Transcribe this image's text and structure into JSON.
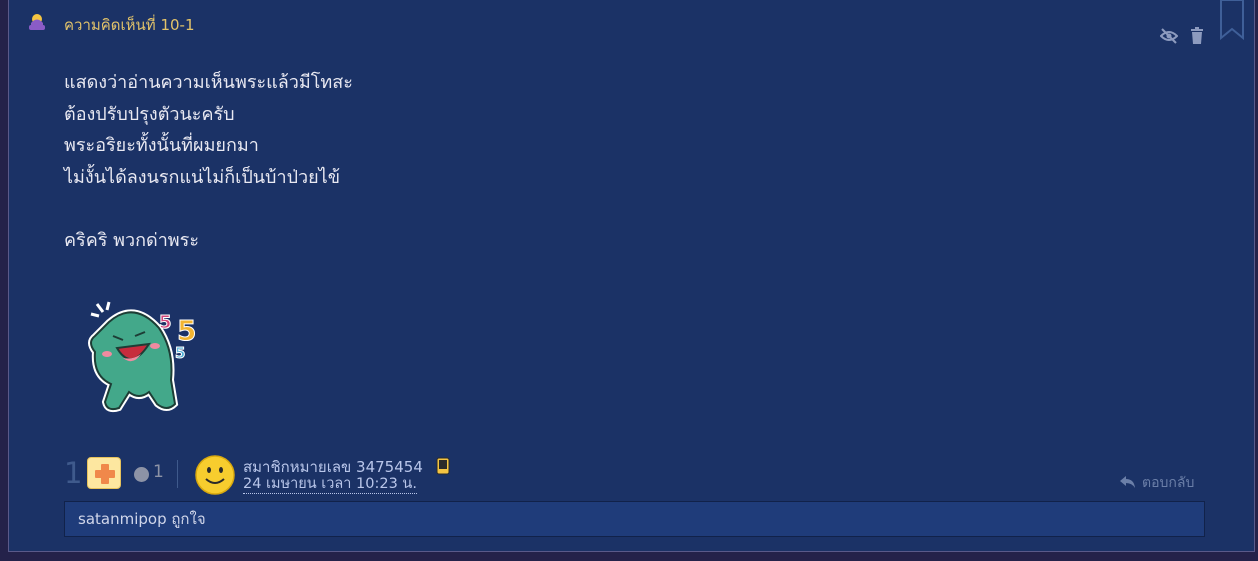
{
  "comment": {
    "header": {
      "title": "ความคิดเห็นที่ 10-1"
    },
    "actions": {
      "hide_icon": "eye-off-icon",
      "delete_icon": "trash-icon"
    },
    "body_lines": [
      "แสดงว่าอ่านความเห็นพระแล้วมีโทสะ",
      "ต้องปรับปรุงตัวนะครับ",
      "พระอริยะทั้งนั้นที่ผมยกมา",
      "ไม่งั้นได้ลงนรกแน่ไม่ก็เป็นบ้าป่วยไข้",
      "",
      "คริคริ พวกด่าพระ"
    ],
    "sticker": {
      "digits": [
        "5",
        "5",
        "5"
      ],
      "colors": [
        "#d0457a",
        "#f2b431",
        "#4fb0d8"
      ]
    },
    "footer": {
      "score": "1",
      "plus_icon": "plus-vote-icon",
      "emotion_count": "1",
      "author": "สมาชิกหมายเลข 3475454",
      "date": "24 เมษายน เวลา 10:23 น.",
      "reply_label": "ตอบกลับ"
    },
    "likers": "satanmipop ถูกใจ"
  },
  "colors": {
    "card_bg": "#1b3266",
    "title": "#e2c36a",
    "text": "#e9e9f2",
    "muted": "#6b7fa8"
  }
}
